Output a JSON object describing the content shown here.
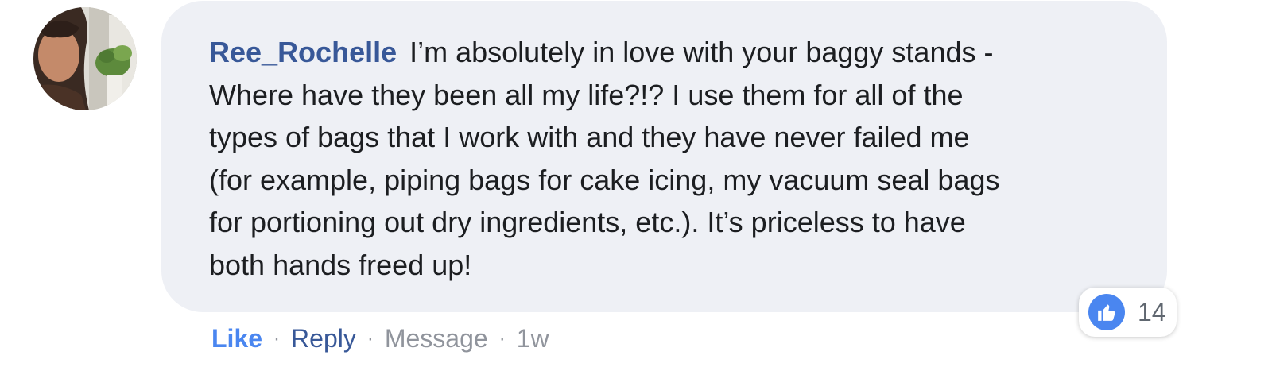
{
  "comment": {
    "author": "Ree_Rochelle",
    "body": "I’m absolutely in love with your baggy stands -\nWhere have they been all my life?!? I use them for all of the\ntypes of bags that I work with and they have never failed me\n(for example, piping bags for cake icing, my vacuum seal bags\nfor portioning out dry ingredients, etc.).  It’s priceless to have\nboth hands freed up!",
    "avatar_icon": "profile-photo"
  },
  "reactions": {
    "icon": "thumbs-up-icon",
    "count": "14",
    "color": "#4a86f0"
  },
  "actions": {
    "like": "Like",
    "reply": "Reply",
    "message": "Message",
    "time": "1w",
    "separator": "·"
  },
  "colors": {
    "bubble_bg": "#eef0f5",
    "author": "#385898",
    "like_link": "#4a86f0",
    "meta": "#90949c"
  }
}
